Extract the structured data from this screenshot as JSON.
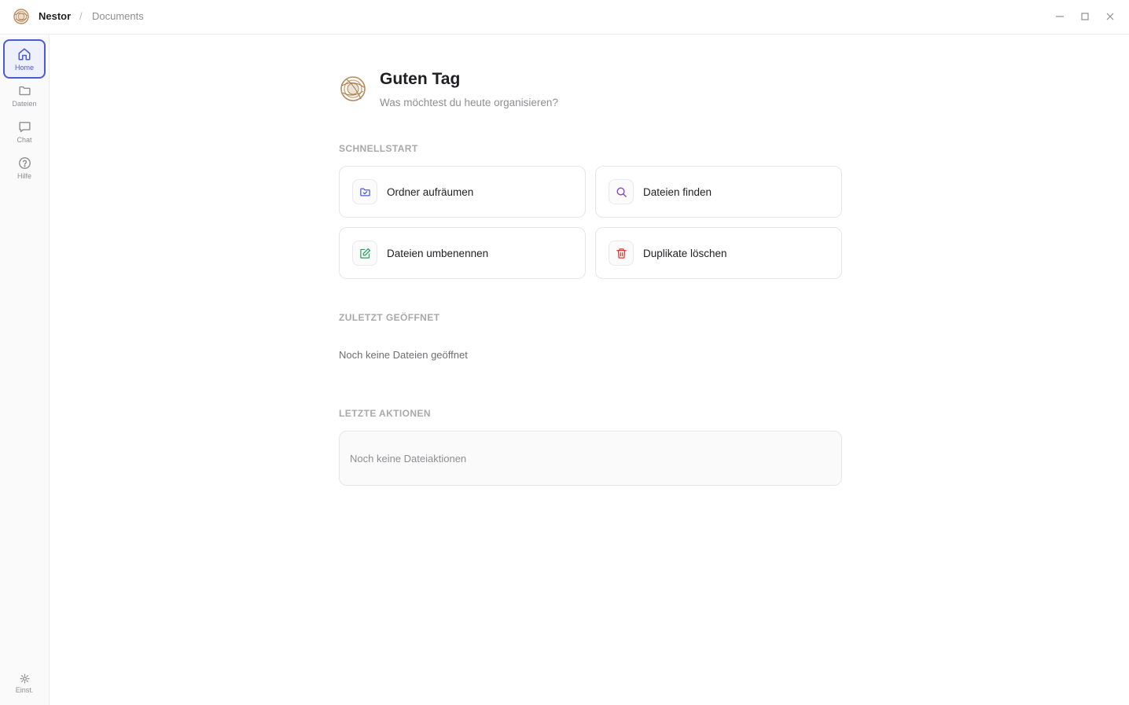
{
  "titlebar": {
    "app_name": "Nestor",
    "separator": "/",
    "breadcrumb": "Documents"
  },
  "sidebar": {
    "items": [
      {
        "label": "Home",
        "icon": "home-icon",
        "active": true
      },
      {
        "label": "Dateien",
        "icon": "folder-icon",
        "active": false
      },
      {
        "label": "Chat",
        "icon": "chat-icon",
        "active": false
      },
      {
        "label": "Hilfe",
        "icon": "help-icon",
        "active": false
      }
    ],
    "settings_label": "Einst."
  },
  "main": {
    "greeting": "Guten Tag",
    "subtitle": "Was möchtest du heute organisieren?",
    "quickstart": {
      "title": "SCHNELLSTART",
      "cards": [
        {
          "label": "Ordner aufräumen",
          "icon": "folder-organize-icon",
          "color": "#4a5bd4"
        },
        {
          "label": "Dateien finden",
          "icon": "search-icon",
          "color": "#8b3fd1"
        },
        {
          "label": "Dateien umbenennen",
          "icon": "edit-icon",
          "color": "#2e9e62"
        },
        {
          "label": "Duplikate löschen",
          "icon": "trash-icon",
          "color": "#d9342b"
        }
      ]
    },
    "recent": {
      "title": "ZULETZT GEÖFFNET",
      "empty": "Noch keine Dateien geöffnet"
    },
    "actions": {
      "title": "LETZTE AKTIONEN",
      "empty": "Noch keine Dateiaktionen"
    }
  },
  "colors": {
    "accent": "#4a5bd4",
    "muted": "#8e8e93"
  }
}
